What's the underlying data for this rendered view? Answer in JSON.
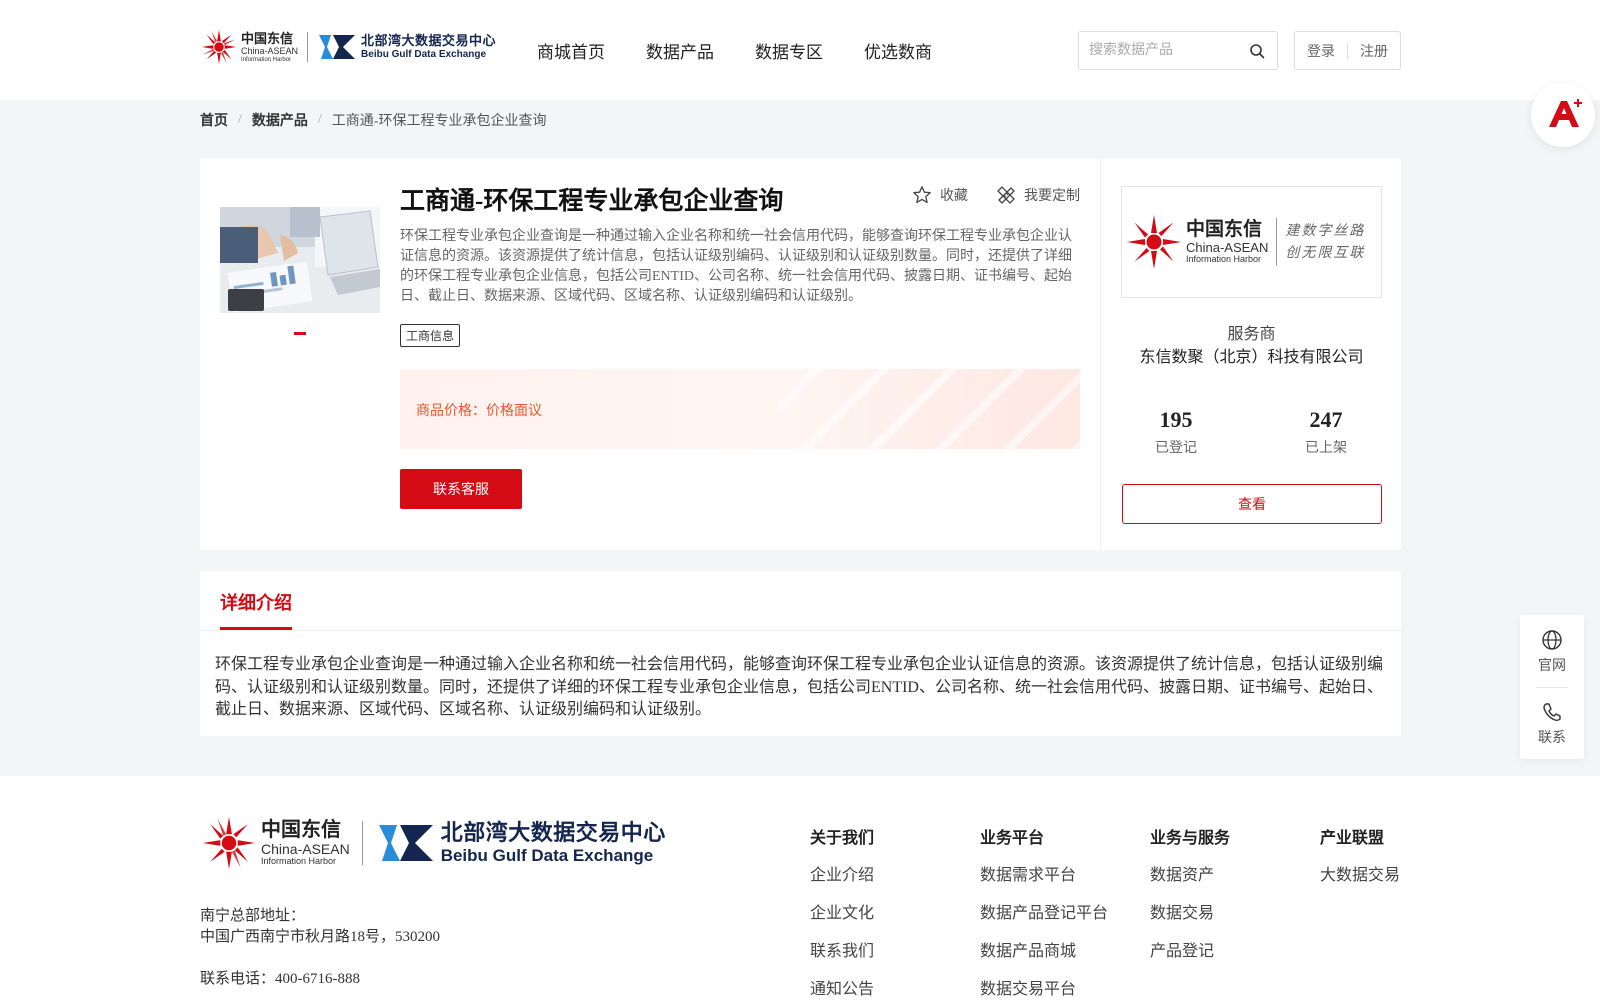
{
  "brand": {
    "cn_name": "中国东信",
    "en_name": "China-ASEAN",
    "en_sub": "Information Harbor",
    "bb_cn": "北部湾大数据交易中心",
    "bb_en": "Beibu Gulf Data Exchange",
    "slogan_1": "建数字丝路",
    "slogan_2": "创无限互联"
  },
  "nav": {
    "items": [
      "商城首页",
      "数据产品",
      "数据专区",
      "优选数商"
    ]
  },
  "search": {
    "placeholder": "搜索数据产品",
    "value": ""
  },
  "auth": {
    "login": "登录",
    "register": "注册"
  },
  "breadcrumb": {
    "home": "首页",
    "category": "数据产品",
    "separator": "/",
    "current": "工商通-环保工程专业承包企业查询"
  },
  "product": {
    "title": "工商通-环保工程专业承包企业查询",
    "favorite": "收藏",
    "customize": "我要定制",
    "description": "环保工程专业承包企业查询是一种通过输入企业名称和统一社会信用代码，能够查询环保工程专业承包企业认证信息的资源。该资源提供了统计信息，包括认证级别编码、认证级别和认证级别数量。同时，还提供了详细的环保工程专业承包企业信息，包括公司ENTID、公司名称、统一社会信用代码、披露日期、证书编号、起始日、截止日、数据来源、区域代码、区域名称、认证级别编码和认证级别。",
    "tag": "工商信息",
    "price_label": "商品价格：",
    "price_value": "价格面议",
    "contact_button": "联系客服"
  },
  "supplier": {
    "role": "服务商",
    "name": "东信数聚（北京）科技有限公司",
    "registered_count": "195",
    "registered_label": "已登记",
    "listed_count": "247",
    "listed_label": "已上架",
    "view_button": "查看"
  },
  "detail": {
    "tab": "详细介绍",
    "text": "环保工程专业承包企业查询是一种通过输入企业名称和统一社会信用代码，能够查询环保工程专业承包企业认证信息的资源。该资源提供了统计信息，包括认证级别编码、认证级别和认证级别数量。同时，还提供了详细的环保工程专业承包企业信息，包括公司ENTID、公司名称、统一社会信用代码、披露日期、证书编号、起始日、截止日、数据来源、区域代码、区域名称、认证级别编码和认证级别。"
  },
  "float_bar": {
    "website": "官网",
    "contact": "联系"
  },
  "footer": {
    "address_label": "南宁总部地址：",
    "address": "中国广西南宁市秋月路18号，530200",
    "phone": "联系电话：400-6716-888",
    "columns": [
      {
        "title": "关于我们",
        "links": [
          "企业介绍",
          "企业文化",
          "联系我们",
          "通知公告"
        ]
      },
      {
        "title": "业务平台",
        "links": [
          "数据需求平台",
          "数据产品登记平台",
          "数据产品商城",
          "数据交易平台"
        ]
      },
      {
        "title": "业务与服务",
        "links": [
          "数据资产",
          "数据交易",
          "产品登记"
        ]
      },
      {
        "title": "产业联盟",
        "links": [
          "大数据交易"
        ]
      }
    ]
  },
  "colors": {
    "brand_red": "#d40a14",
    "price_orange": "#e8572c",
    "navy": "#14264f",
    "bb_blue": "#2a8bd8"
  },
  "icons": [
    "search-icon",
    "star-icon",
    "customize-icon",
    "globe-icon",
    "phone-icon",
    "ai-assistant-icon"
  ]
}
